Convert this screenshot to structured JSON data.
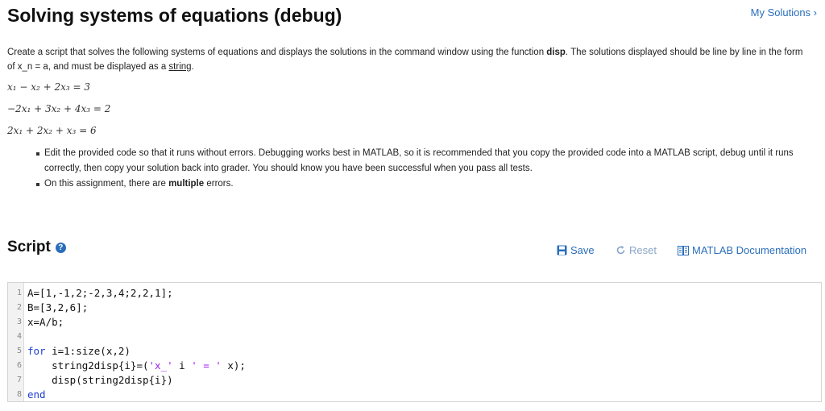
{
  "header": {
    "title": "Solving systems of equations (debug)",
    "my_solutions": "My Solutions ›"
  },
  "description": {
    "part1": "Create a script that solves the following systems of equations and displays the solutions in the command window using the function ",
    "func": "disp",
    "part2": ". The solutions displayed should be line by line in the form of x_n = a, and must be displayed as a ",
    "string_word": "string",
    "part3": "."
  },
  "equations": [
    "x₁ − x₂ + 2x₃ = 3",
    "−2x₁ + 3x₂ + 4x₃ = 2",
    "2x₁ + 2x₂ + x₃ = 6"
  ],
  "bullets": {
    "item1": "Edit the provided code so that it runs without errors. Debugging works best in MATLAB, so it is recommended that you copy the provided code into a MATLAB script, debug until it runs correctly, then copy your solution back into grader. You should know you have been successful when you pass all tests.",
    "item2_pre": "On this assignment, there are ",
    "item2_bold": "multiple",
    "item2_post": " errors."
  },
  "script": {
    "title": "Script",
    "help_icon": "question-circle-icon",
    "save_label": "Save",
    "reset_label": "Reset",
    "doc_label": "MATLAB Documentation"
  },
  "code_lines": [
    {
      "n": "1",
      "text": "A=[1,-1,2;-2,3,4;2,2,1];"
    },
    {
      "n": "2",
      "text": "B=[3,2,6];"
    },
    {
      "n": "3",
      "text": "x=A/b;"
    },
    {
      "n": "4",
      "text": ""
    },
    {
      "n": "5",
      "kw": "for",
      "text": " i=1:size(x,2)"
    },
    {
      "n": "6",
      "pre": "    string2disp{i}=(",
      "s1": "'x_'",
      "mid": " i ",
      "s2": "' = '",
      "post": " x);"
    },
    {
      "n": "7",
      "text": "    disp(string2disp{i})"
    },
    {
      "n": "8",
      "kw": "end",
      "text": ""
    }
  ],
  "colors": {
    "accent": "#2a6ebb",
    "keyword": "#1f3fd6",
    "string": "#a020f0"
  }
}
